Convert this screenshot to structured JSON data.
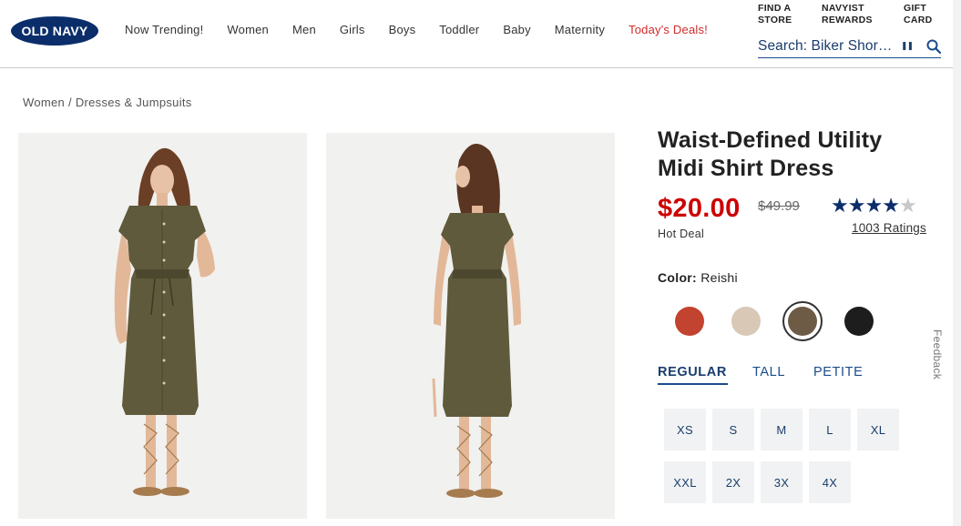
{
  "header": {
    "logo": "OLD NAVY",
    "nav": [
      "Now Trending!",
      "Women",
      "Men",
      "Girls",
      "Boys",
      "Toddler",
      "Baby",
      "Maternity",
      "Today's Deals!"
    ],
    "utility": [
      {
        "line1": "FIND A",
        "line2": "STORE"
      },
      {
        "line1": "NAVYIST",
        "line2": "REWARDS"
      },
      {
        "line1": "GIFT",
        "line2": "CARD"
      }
    ],
    "search_text": "Search: Biker Shor…",
    "pause_glyph": "❚❚"
  },
  "breadcrumb": {
    "part1": "Women",
    "sep": " / ",
    "part2": "Dresses & Jumpsuits"
  },
  "product": {
    "title_line1": "Waist-Defined Utility",
    "title_line2": "Midi Shirt Dress",
    "price": "$20.00",
    "was_price": "$49.99",
    "deal_label": "Hot Deal",
    "rating": 4.5,
    "ratings_text": "1003 Ratings",
    "color_label": "Color:",
    "color_value": "Reishi",
    "colors": [
      {
        "name": "red",
        "hex": "#c2432f"
      },
      {
        "name": "beige",
        "hex": "#d9c8b6"
      },
      {
        "name": "reishi",
        "hex": "#6e5b45"
      },
      {
        "name": "black",
        "hex": "#1d1d1d"
      }
    ],
    "fits": [
      "REGULAR",
      "TALL",
      "PETITE"
    ],
    "sizes": [
      "XS",
      "S",
      "M",
      "L",
      "XL",
      "XXL",
      "2X",
      "3X",
      "4X"
    ]
  },
  "feedback": "Feedback",
  "colors": {
    "brand_navy": "#0b2e6b",
    "price_red": "#cc0000",
    "deals_red": "#d12a2a"
  }
}
